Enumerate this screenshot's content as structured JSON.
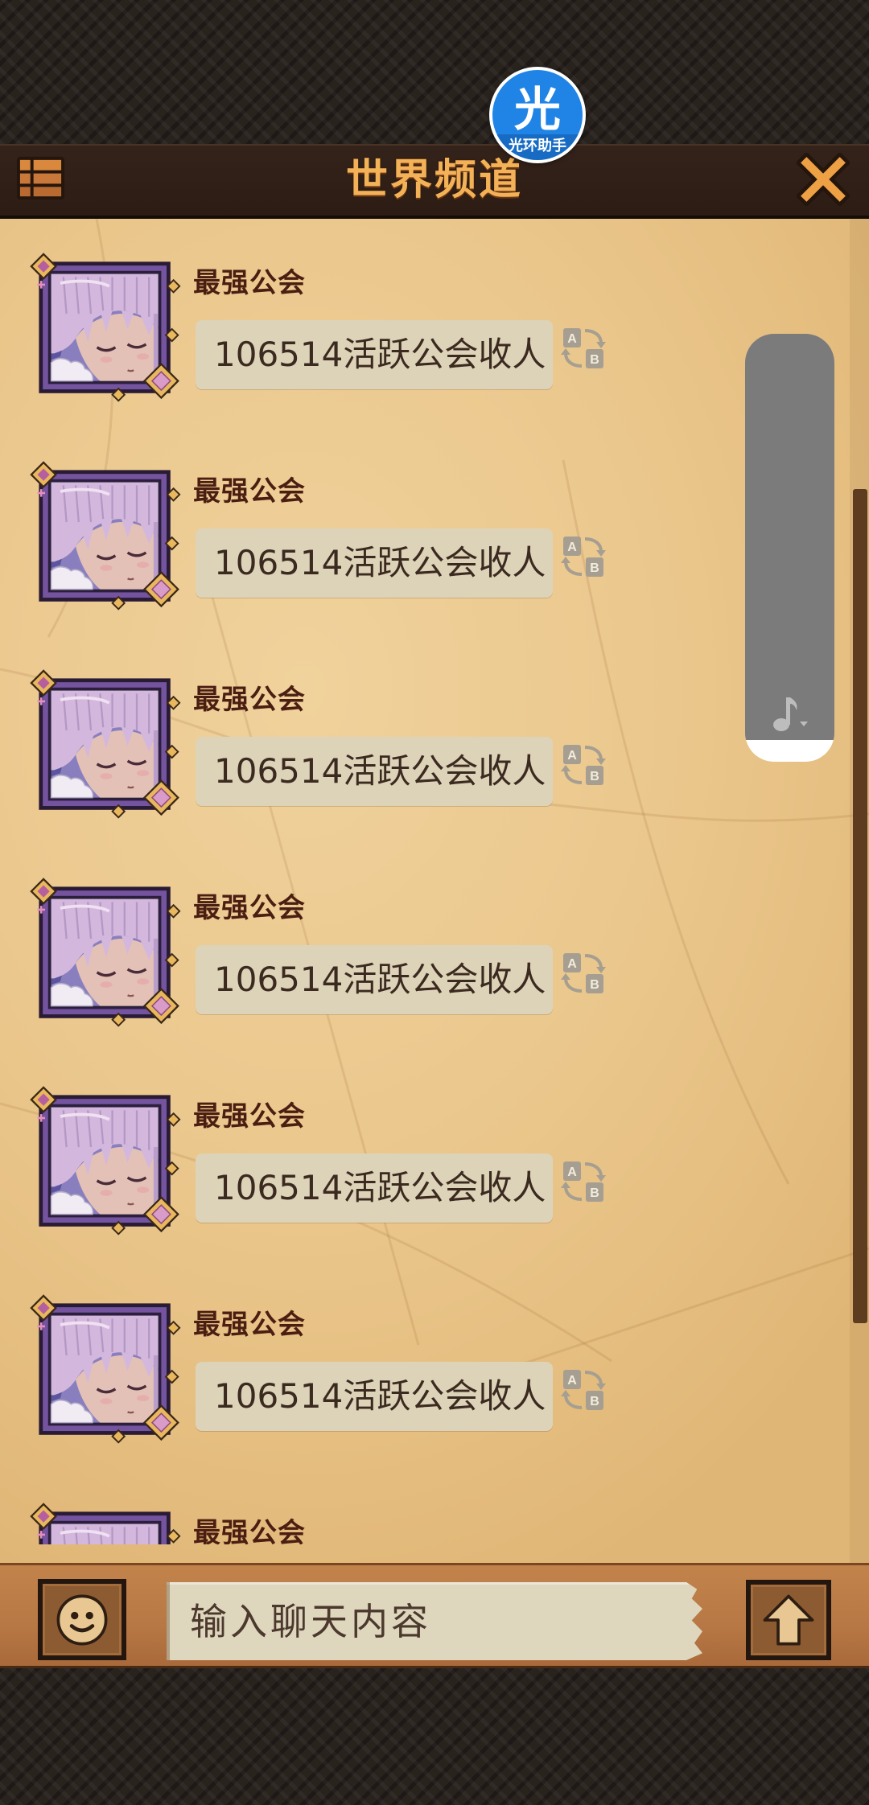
{
  "overlay_badge": {
    "glyph": "光",
    "label": "光环助手"
  },
  "header": {
    "title": "世界频道",
    "menu_icon": "menu-icon",
    "close_icon": "close-icon"
  },
  "messages": [
    {
      "sender": "最强公会",
      "text": "106514活跃公会收人"
    },
    {
      "sender": "最强公会",
      "text": "106514活跃公会收人"
    },
    {
      "sender": "最强公会",
      "text": "106514活跃公会收人"
    },
    {
      "sender": "最强公会",
      "text": "106514活跃公会收人"
    },
    {
      "sender": "最强公会",
      "text": "106514活跃公会收人"
    },
    {
      "sender": "最强公会",
      "text": "106514活跃公会收人"
    },
    {
      "sender": "最强公会"
    }
  ],
  "message_icons": {
    "avatar": "avatar-icon",
    "translate": "translate-icon"
  },
  "translate_button": {
    "letter_a": "A",
    "letter_b": "B"
  },
  "music_widget": {
    "icon": "music-note-icon"
  },
  "composer": {
    "placeholder": "输入聊天内容",
    "emoji_icon": "emoji-face-icon",
    "send_icon": "send-arrow-icon"
  },
  "colors": {
    "header_bg": "#2c1c14",
    "title_gold": "#f3b257",
    "parchment": "#eac68b",
    "sender_name": "#4b1e12",
    "bubble_bg": "#ddd3b8",
    "composer_bar": "#b77845",
    "badge_blue": "#1f84e6",
    "music_widget_gray": "#7b7b7b"
  }
}
